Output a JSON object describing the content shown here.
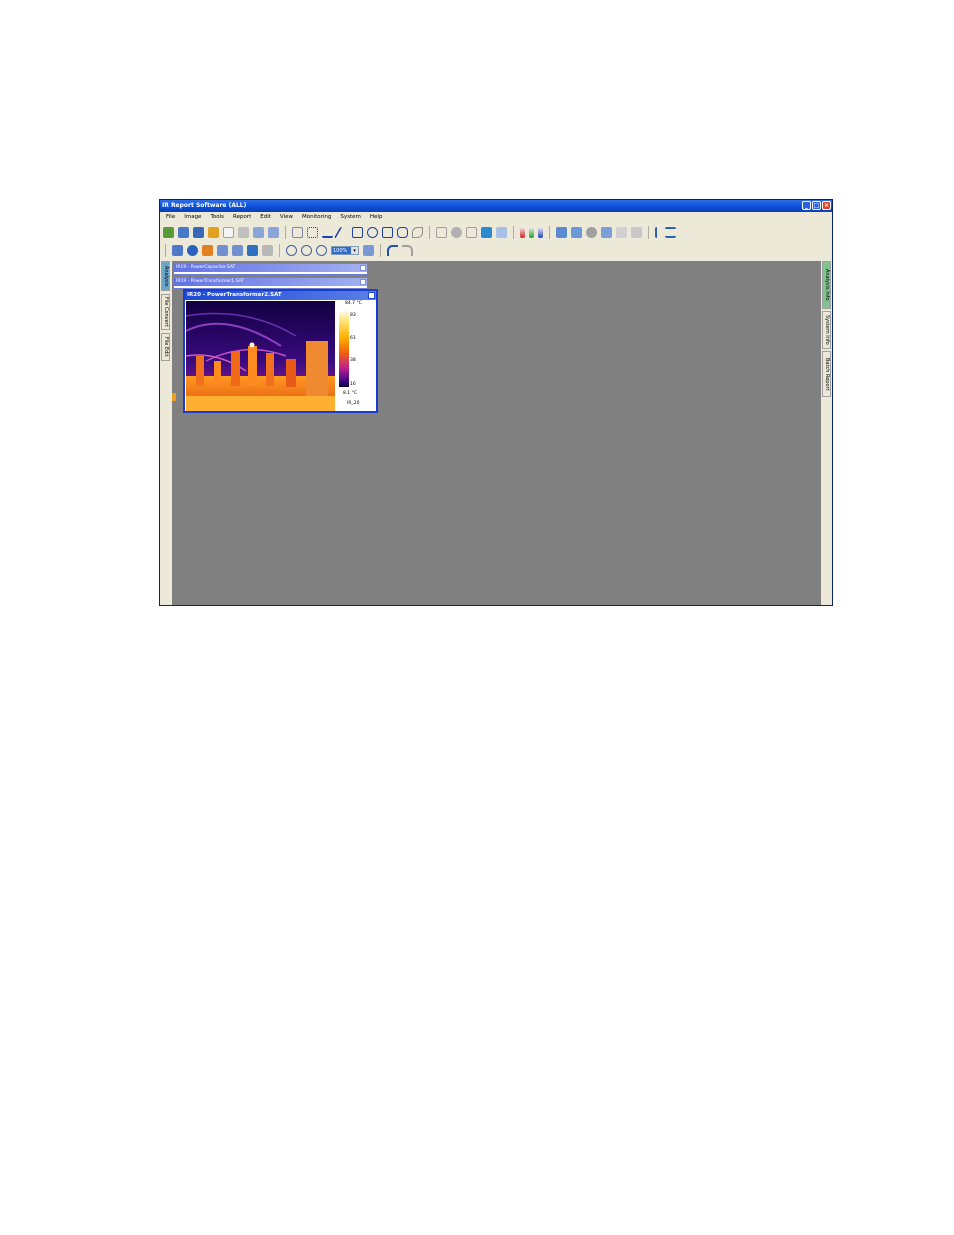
{
  "window": {
    "title": "IR Report Software (ALL)",
    "controls": [
      "_",
      "□",
      "×"
    ]
  },
  "menu": [
    "File",
    "Image",
    "Tools",
    "Report",
    "Edit",
    "View",
    "Monitoring",
    "System",
    "Help"
  ],
  "toolbar": {
    "zoom_value": "100%"
  },
  "left_tabs": [
    "Analysis",
    "File Convert",
    "File Edit"
  ],
  "right_tabs": [
    "Analysis Info",
    "System Info",
    "Batch Report"
  ],
  "child_windows": [
    {
      "title": "IR19 - PowerCapacitor.SAT"
    },
    {
      "title": "IR19 - PowerTransformer1.SAT"
    }
  ],
  "active_window": {
    "title": "IR20 - PowerTransformer2.SAT",
    "scale": {
      "max": "84.7 °C",
      "ticks": [
        "83",
        "61",
        "38",
        "16"
      ],
      "min": "8.1 °C",
      "label": "IR_20"
    }
  },
  "colors": {
    "titlebar": "#0a4fd6",
    "workspace": "#808080",
    "chrome": "#ece9d8"
  }
}
